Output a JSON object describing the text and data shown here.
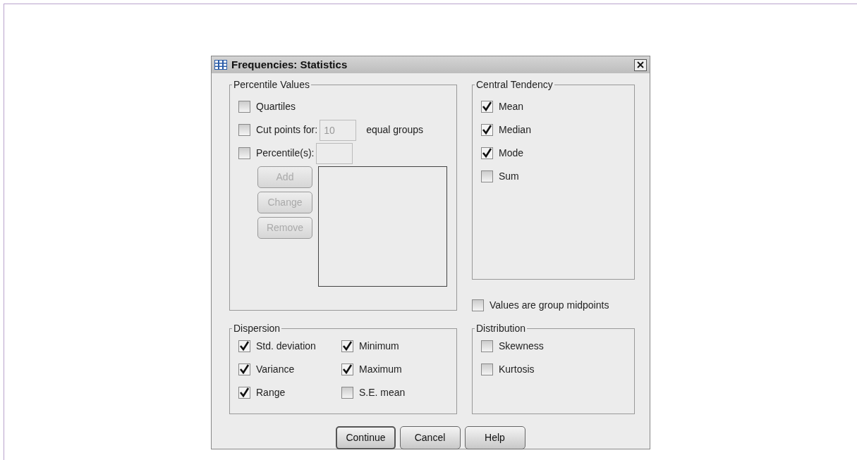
{
  "window": {
    "title": "Frequencies: Statistics"
  },
  "percentile_values": {
    "title": "Percentile Values",
    "options": [
      {
        "kind": "checkbox",
        "label": "Quartiles",
        "checked": false
      },
      {
        "kind": "field",
        "label": "Cut points for:",
        "checked": false,
        "value": "10",
        "field_disabled": true,
        "suffix": "equal groups"
      },
      {
        "kind": "field",
        "label": "Percentile(s):",
        "checked": false,
        "field_disabled": true
      }
    ],
    "buttons": [
      {
        "label": "Add",
        "disabled": true
      },
      {
        "label": "Change",
        "disabled": true
      },
      {
        "label": "Remove",
        "disabled": true
      }
    ]
  },
  "central_tendency": {
    "title": "Central Tendency",
    "options": [
      {
        "label": "Mean",
        "checked": true
      },
      {
        "label": "Median",
        "checked": true
      },
      {
        "label": "Mode",
        "checked": true
      },
      {
        "label": "Sum",
        "checked": false
      }
    ]
  },
  "group_midpoints": {
    "label": "Values are group midpoints",
    "checked": false
  },
  "dispersion": {
    "title": "Dispersion",
    "options": [
      {
        "label": "Std. deviation",
        "checked": true
      },
      {
        "label": "Minimum",
        "checked": true
      },
      {
        "label": "Variance",
        "checked": true
      },
      {
        "label": "Maximum",
        "checked": true
      },
      {
        "label": "Range",
        "checked": true
      },
      {
        "label": "S.E. mean",
        "checked": false
      }
    ]
  },
  "distribution": {
    "title": "Distribution",
    "options": [
      {
        "label": "Skewness",
        "checked": false
      },
      {
        "label": "Kurtosis",
        "checked": false
      }
    ]
  },
  "buttons": [
    {
      "label": "Continue",
      "default": true
    },
    {
      "label": "Cancel",
      "default": false
    },
    {
      "label": "Help",
      "default": false
    }
  ]
}
